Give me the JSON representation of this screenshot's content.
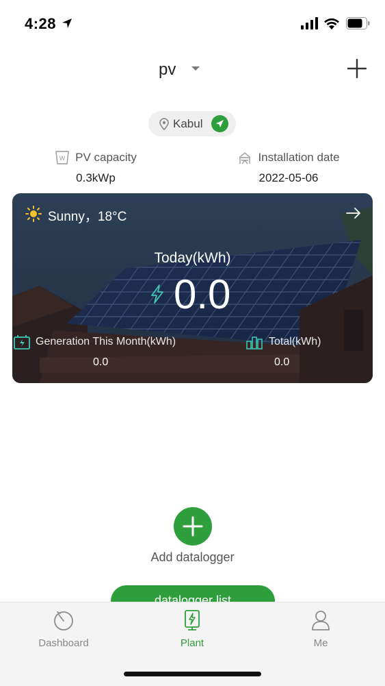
{
  "status_bar": {
    "time": "4:28"
  },
  "header": {
    "plant_name": "pv"
  },
  "location": {
    "city": "Kabul"
  },
  "plant_info": {
    "pv_capacity_label": "PV capacity",
    "pv_capacity_value": "0.3kWp",
    "installation_date_label": "Installation date",
    "installation_date_value": "2022-05-06"
  },
  "summary_card": {
    "weather": "Sunny，18°C",
    "today_label": "Today(kWh)",
    "today_value": "0.0",
    "generation_month_label": "Generation This Month(kWh)",
    "generation_month_value": "0.0",
    "total_label": "Total(kWh)",
    "total_value": "0.0"
  },
  "datalogger": {
    "add_label": "Add datalogger",
    "list_button_label": "datalogger list"
  },
  "tabbar": {
    "tabs": [
      {
        "label": "Dashboard",
        "icon": "dashboard-icon",
        "active": false
      },
      {
        "label": "Plant",
        "icon": "plant-icon",
        "active": true
      },
      {
        "label": "Me",
        "icon": "user-icon",
        "active": false
      }
    ]
  },
  "colors": {
    "accent": "#2f9e3c",
    "teal_icon": "#3fc8b4"
  }
}
